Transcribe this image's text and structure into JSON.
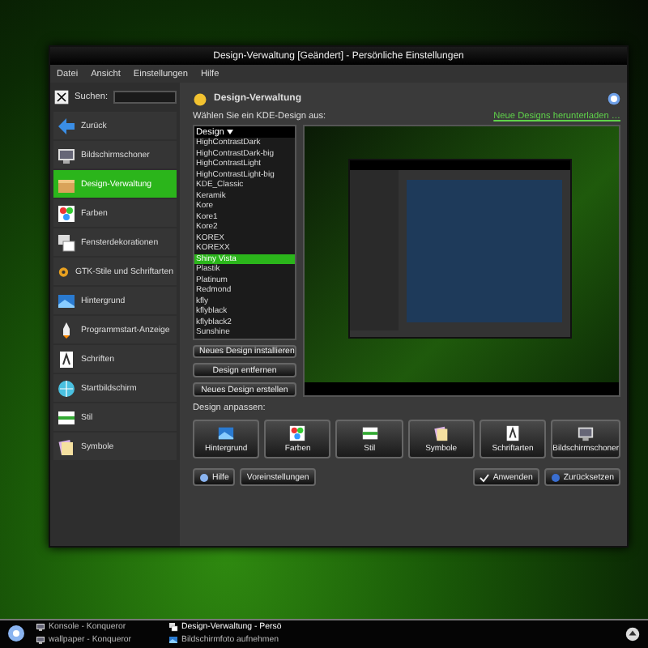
{
  "window": {
    "title": "Design-Verwaltung [Geändert] - Persönliche Einstellungen"
  },
  "menu": [
    "Datei",
    "Ansicht",
    "Einstellungen",
    "Hilfe"
  ],
  "sidebar": {
    "search_label": "Suchen:",
    "items": [
      {
        "label": "Zurück",
        "selected": false
      },
      {
        "label": "Bildschirmschoner",
        "selected": false
      },
      {
        "label": "Design-Verwaltung",
        "selected": true
      },
      {
        "label": "Farben",
        "selected": false
      },
      {
        "label": "Fensterdekorationen",
        "selected": false
      },
      {
        "label": "GTK-Stile und Schriftarten",
        "selected": false
      },
      {
        "label": "Hintergrund",
        "selected": false
      },
      {
        "label": "Programmstart-Anzeige",
        "selected": false
      },
      {
        "label": "Schriften",
        "selected": false
      },
      {
        "label": "Startbildschirm",
        "selected": false
      },
      {
        "label": "Stil",
        "selected": false
      },
      {
        "label": "Symbole",
        "selected": false
      }
    ]
  },
  "panel": {
    "title": "Design-Verwaltung",
    "prompt": "Wählen Sie ein KDE-Design aus:",
    "download_link": "Neue Designs herunterladen …",
    "list_header": "Design",
    "themes": [
      {
        "label": "HighContrastDark",
        "selected": false
      },
      {
        "label": "HighContrastDark-big",
        "selected": false
      },
      {
        "label": "HighContrastLight",
        "selected": false
      },
      {
        "label": "HighContrastLight-big",
        "selected": false
      },
      {
        "label": "KDE_Classic",
        "selected": false
      },
      {
        "label": "Keramik",
        "selected": false
      },
      {
        "label": "Kore",
        "selected": false
      },
      {
        "label": "Kore1",
        "selected": false
      },
      {
        "label": "Kore2",
        "selected": false
      },
      {
        "label": "KOREX",
        "selected": false
      },
      {
        "label": "KOREXX",
        "selected": false
      },
      {
        "label": "Shiny Vista",
        "selected": true
      },
      {
        "label": "Plastik",
        "selected": false
      },
      {
        "label": "Platinum",
        "selected": false
      },
      {
        "label": "Redmond",
        "selected": false
      },
      {
        "label": "kfly",
        "selected": false
      },
      {
        "label": "kflyblack",
        "selected": false
      },
      {
        "label": "kflyblack2",
        "selected": false
      },
      {
        "label": "Sunshine",
        "selected": false
      }
    ],
    "theme_buttons": [
      "Neues Design installieren",
      "Design entfernen",
      "Neues Design erstellen"
    ],
    "customize_label": "Design anpassen:",
    "customize_buttons": [
      "Hintergrund",
      "Farben",
      "Stil",
      "Symbole",
      "Schriftarten",
      "Bildschirmschoner"
    ]
  },
  "footer": {
    "left": [
      "Hilfe",
      "Voreinstellungen"
    ],
    "right": [
      "Anwenden",
      "Zurücksetzen"
    ]
  },
  "taskbar": {
    "tasks": [
      "Konsole - Konqueror",
      "wallpaper - Konqueror",
      "Design-Verwaltung - Persö",
      "Bildschirmfoto aufnehmen"
    ]
  }
}
